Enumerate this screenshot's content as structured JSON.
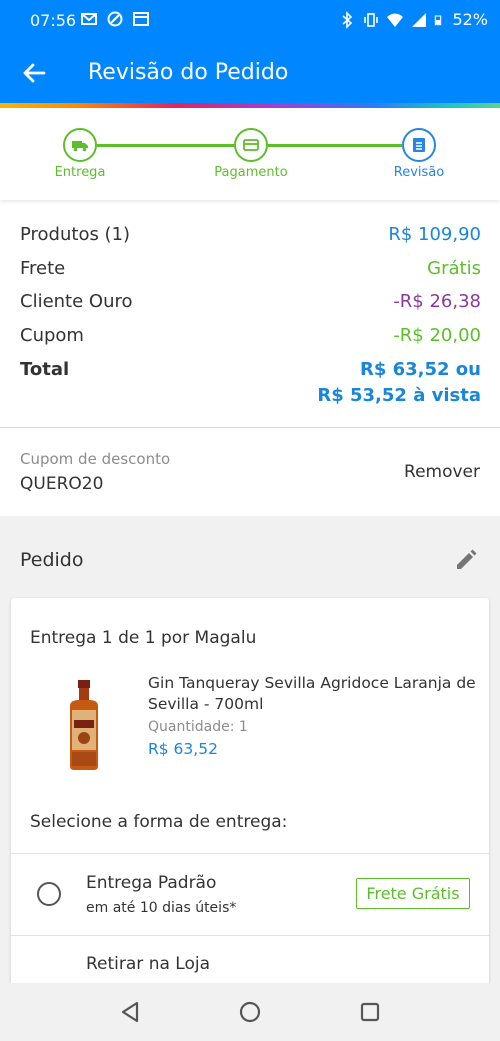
{
  "status_bar": {
    "time": "07:56",
    "battery": "52%",
    "left_icons": [
      "mail-icon",
      "sync-icon",
      "calendar-icon"
    ],
    "right_icons": [
      "bluetooth-icon",
      "vibrate-icon",
      "wifi-icon",
      "signal-icon",
      "battery-icon"
    ]
  },
  "app_bar": {
    "title": "Revisão do Pedido",
    "back_icon": "arrow-left-icon",
    "color": "#0086ff"
  },
  "stepper": {
    "steps": [
      {
        "label": "Entrega",
        "icon": "truck-icon",
        "state": "done"
      },
      {
        "label": "Pagamento",
        "icon": "card-icon",
        "state": "done"
      },
      {
        "label": "Revisão",
        "icon": "list-icon",
        "state": "current"
      }
    ],
    "done_color": "#5cbf2a",
    "current_color": "#2886e3"
  },
  "summary": {
    "products_label": "Produtos (1)",
    "products_value": "R$ 109,90",
    "shipping_label": "Frete",
    "shipping_value": "Grátis",
    "gold_label": "Cliente Ouro",
    "gold_value": "-R$ 26,38",
    "coupon_label": "Cupom",
    "coupon_value": "-R$ 20,00",
    "total_label": "Total",
    "total_value_1": "R$ 63,52 ou",
    "total_value_2": "R$ 53,52 à vista"
  },
  "coupon": {
    "caption": "Cupom de desconto",
    "code": "QUERO20",
    "remove_label": "Remover"
  },
  "order": {
    "title": "Pedido",
    "delivery_title": "Entrega 1 de 1 por Magalu",
    "product": {
      "name": "Gin Tanqueray Sevilla Agridoce Laranja de Sevilla - 700ml",
      "quantity": "Quantidade:  1",
      "price": "R$ 63,52"
    },
    "shipping_caption": "Selecione a forma de entrega:",
    "options": [
      {
        "title": "Entrega Padrão",
        "subtitle": "em até 10 dias úteis*",
        "badge": "Frete Grátis"
      },
      {
        "title": "Retirar na Loja"
      }
    ]
  },
  "nav_bar": {
    "buttons": [
      "back-triangle-icon",
      "home-circle-icon",
      "recents-square-icon"
    ]
  }
}
